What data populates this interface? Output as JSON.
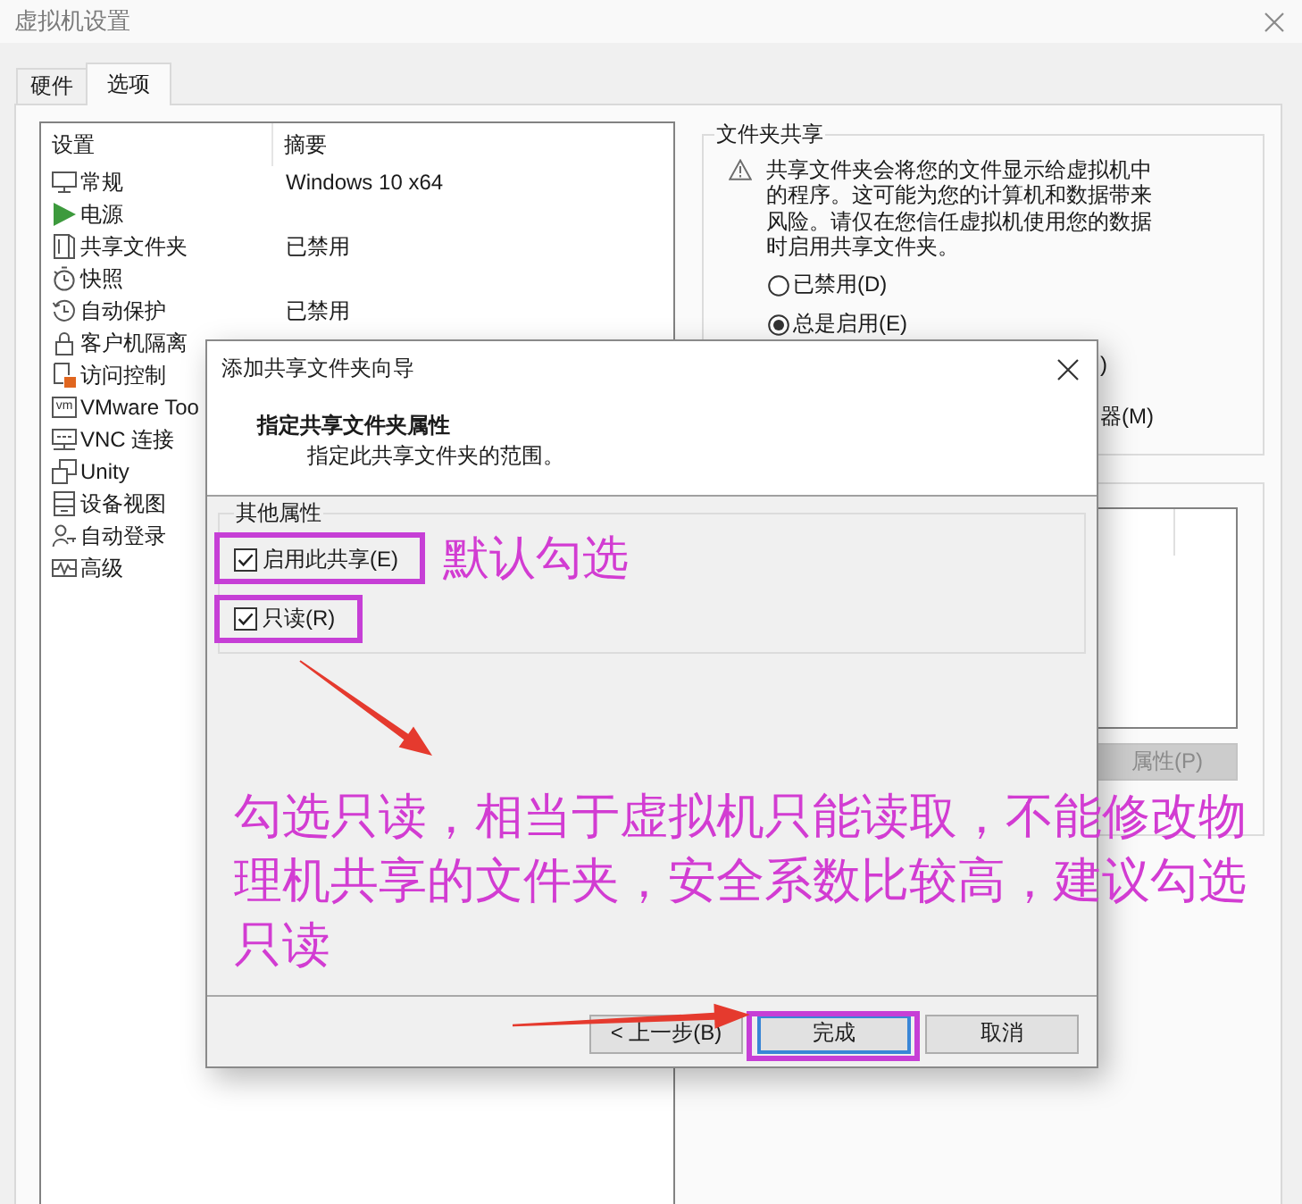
{
  "window": {
    "title": "虚拟机设置"
  },
  "tabs": [
    {
      "label": "硬件",
      "selected": false
    },
    {
      "label": "选项",
      "selected": true
    }
  ],
  "settings_list": {
    "columns": [
      "设置",
      "摘要"
    ],
    "rows": [
      {
        "name": "常规",
        "summary": "Windows 10 x64"
      },
      {
        "name": "电源"
      },
      {
        "name": "共享文件夹",
        "summary": "已禁用"
      },
      {
        "name": "快照"
      },
      {
        "name": "自动保护",
        "summary": "已禁用"
      },
      {
        "name": "客户机隔离"
      },
      {
        "name": "访问控制"
      },
      {
        "name": "VMware Too",
        "icon_label": "vm"
      },
      {
        "name": "VNC 连接"
      },
      {
        "name": "Unity"
      },
      {
        "name": "设备视图"
      },
      {
        "name": "自动登录"
      },
      {
        "name": "高级"
      }
    ]
  },
  "folder_sharing": {
    "title": "文件夹共享",
    "warning": "共享文件夹会将您的文件显示给虚拟机中的程序。这可能为您的计算机和数据带来风险。请仅在您信任虚拟机使用您的数据时启用共享文件夹。",
    "options": [
      {
        "label": "已禁用(D)",
        "selected": false
      },
      {
        "label": "总是启用(E)",
        "selected": true
      }
    ],
    "covered_texts": [
      ")",
      "器(M)"
    ]
  },
  "folders": {
    "button": {
      "label": "属性(P)",
      "disabled": true
    }
  },
  "dialog": {
    "title": "添加共享文件夹向导",
    "heading": "指定共享文件夹属性",
    "subheading": "指定此共享文件夹的范围。",
    "group": "其他属性",
    "checkboxes": [
      {
        "label": "启用此共享(E)",
        "checked": true
      },
      {
        "label": "只读(R)",
        "checked": true
      }
    ],
    "buttons": [
      {
        "label": "< 上一步(B)",
        "default": false
      },
      {
        "label": "完成",
        "default": true
      },
      {
        "label": "取消",
        "default": false
      }
    ]
  },
  "annotations": {
    "note_default": "默认勾选",
    "note_read_only": "勾选只读，相当于虚拟机只能读取，不能修改物理机共享的文件夹，安全系数比较高，建议勾选只读"
  }
}
